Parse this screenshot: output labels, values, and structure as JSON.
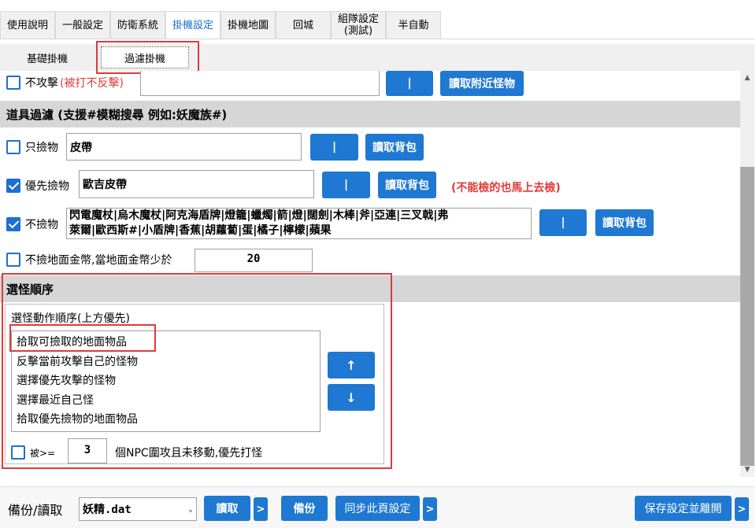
{
  "tabs": [
    {
      "label": "使用說明"
    },
    {
      "label": "一般設定"
    },
    {
      "label": "防衛系統"
    },
    {
      "label": "掛機設定"
    },
    {
      "label": "掛機地圖"
    },
    {
      "label": "回城"
    },
    {
      "label": "組隊設定\n(測試)"
    },
    {
      "label": "半自動"
    }
  ],
  "subtabs": [
    {
      "label": "基礎掛機"
    },
    {
      "label": "過濾掛機"
    }
  ],
  "no_attack": {
    "label": "不攻擊",
    "note": "(被打不反擊)",
    "pipe_button": "|",
    "read_button": "讀取附近怪物"
  },
  "item_filter": {
    "title": "道具過濾 (支援#模糊搜尋 例如:妖魔族#)",
    "pickup_only": {
      "label": "只撿物",
      "value": "皮帶",
      "pipe_button": "|",
      "read_button": "讀取背包"
    },
    "priority_pickup": {
      "label": "優先撿物",
      "value": "歐吉皮帶",
      "pipe_button": "|",
      "read_button": "讀取背包",
      "note": "(不能檢的也馬上去檢)"
    },
    "no_pickup": {
      "label": "不撿物",
      "line1": "閃電魔杖|烏木魔杖|阿克海盾牌|燈籠|蠟燭|箭|燈|闊劍|木棒|斧|亞連|三叉戟|弗",
      "line2": "萊爾|歐西斯#|小盾牌|香蕉|胡蘿蔔|蛋|橘子|檸檬|蘋果",
      "pipe_button": "|",
      "read_button": "讀取背包"
    },
    "no_gold": {
      "label": "不撿地面金幣,當地面金幣少於",
      "value": "20"
    }
  },
  "monster_order": {
    "title": "選怪順序",
    "group_label": "選怪動作順序(上方優先)",
    "items": [
      "拾取可撿取的地面物品",
      "反擊當前攻擊自己的怪物",
      "選擇優先攻擊的怪物",
      "選擇最近自己怪",
      "拾取優先撿物的地面物品"
    ],
    "up_button": "↑",
    "down_button": "↓",
    "npc_label": "被>=",
    "npc_value": "3",
    "npc_suffix": "個NPC圍攻且未移動,優先打怪"
  },
  "bottom": {
    "backup_label": "備份/讀取",
    "file_value": "妖精.dat",
    "read_button": "讀取",
    "more": ">",
    "backup_button": "備份",
    "sync_button": "同步此頁設定",
    "save_button": "保存設定並離開"
  },
  "colors": {
    "accent": "#1f78d1",
    "highlight": "#e03a3a",
    "section_bg": "#d6d6d6"
  }
}
